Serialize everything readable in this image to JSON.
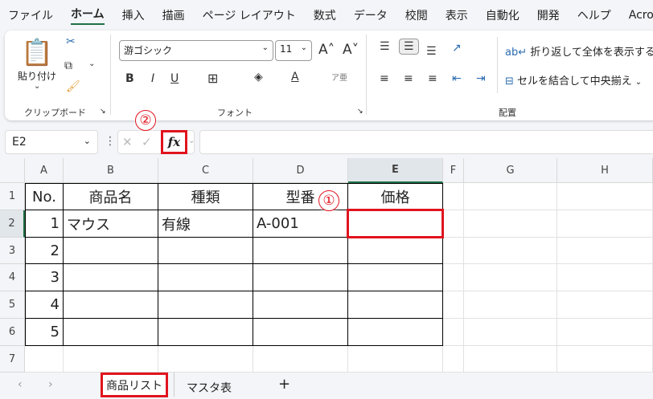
{
  "menu": [
    "ファイル",
    "ホーム",
    "挿入",
    "描画",
    "ページ レイアウト",
    "数式",
    "データ",
    "校閲",
    "表示",
    "自動化",
    "開発",
    "ヘルプ",
    "Acro"
  ],
  "ribbon": {
    "clipboard": {
      "paste": "貼り付け",
      "label": "クリップボード"
    },
    "font": {
      "name": "游ゴシック",
      "size": "11",
      "label": "フォント",
      "bold": "B",
      "italic": "I",
      "underline": "U"
    },
    "alignment": {
      "wrap": "折り返して全体を表示する",
      "merge": "セルを結合して中央揃え",
      "label": "配置"
    }
  },
  "formula_bar": {
    "name_box": "E2",
    "fx": "fx",
    "value": ""
  },
  "columns": [
    "A",
    "B",
    "C",
    "D",
    "E",
    "F",
    "G",
    "H"
  ],
  "rows": [
    "1",
    "2",
    "3",
    "4",
    "5",
    "6",
    "7"
  ],
  "table": {
    "headers": [
      "No.",
      "商品名",
      "種類",
      "型番",
      "価格"
    ],
    "rows": [
      [
        "1",
        "マウス",
        "有線",
        "A-001",
        ""
      ],
      [
        "2",
        "",
        "",
        "",
        ""
      ],
      [
        "3",
        "",
        "",
        "",
        ""
      ],
      [
        "4",
        "",
        "",
        "",
        ""
      ],
      [
        "5",
        "",
        "",
        "",
        ""
      ]
    ]
  },
  "annotations": {
    "step1": "①",
    "step2": "②"
  },
  "sheets": [
    {
      "name": "商品リスト",
      "active": true
    },
    {
      "name": "マスタ表",
      "active": false
    }
  ],
  "add_sheet": "+",
  "colors": {
    "accent": "#1e7145",
    "highlight": "#e0141e"
  }
}
